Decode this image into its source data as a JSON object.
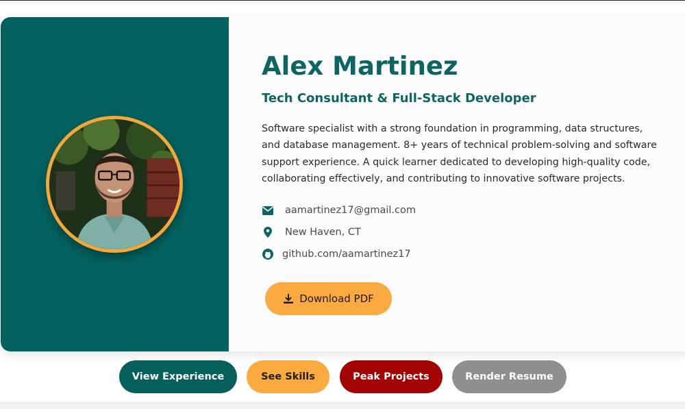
{
  "profile": {
    "name": "Alex Martinez",
    "role": "Tech Consultant & Full-Stack Developer",
    "summary": "Software specialist with a strong foundation in programming, data structures, and database management. 8+ years of technical problem-solving and software support experience. A quick learner dedicated to developing high-quality code, collaborating effectively, and contributing to innovative software projects."
  },
  "contacts": {
    "email": "aamartinez17@gmail.com",
    "location": "New Haven, CT",
    "github": "github.com/aamartinez17"
  },
  "actions": {
    "download_label": "Download PDF"
  },
  "nav": {
    "experience": "View Experience",
    "skills": "See Skills",
    "projects": "Peak Projects",
    "resume": "Render Resume"
  },
  "icons": {
    "email": "envelope-icon",
    "location": "map-pin-icon",
    "github": "github-icon",
    "download": "download-icon"
  },
  "colors": {
    "brand_teal": "#03625f",
    "accent_orange": "#fbaa40",
    "projects_red": "#a30202",
    "resume_gray": "#8f8f8f"
  }
}
